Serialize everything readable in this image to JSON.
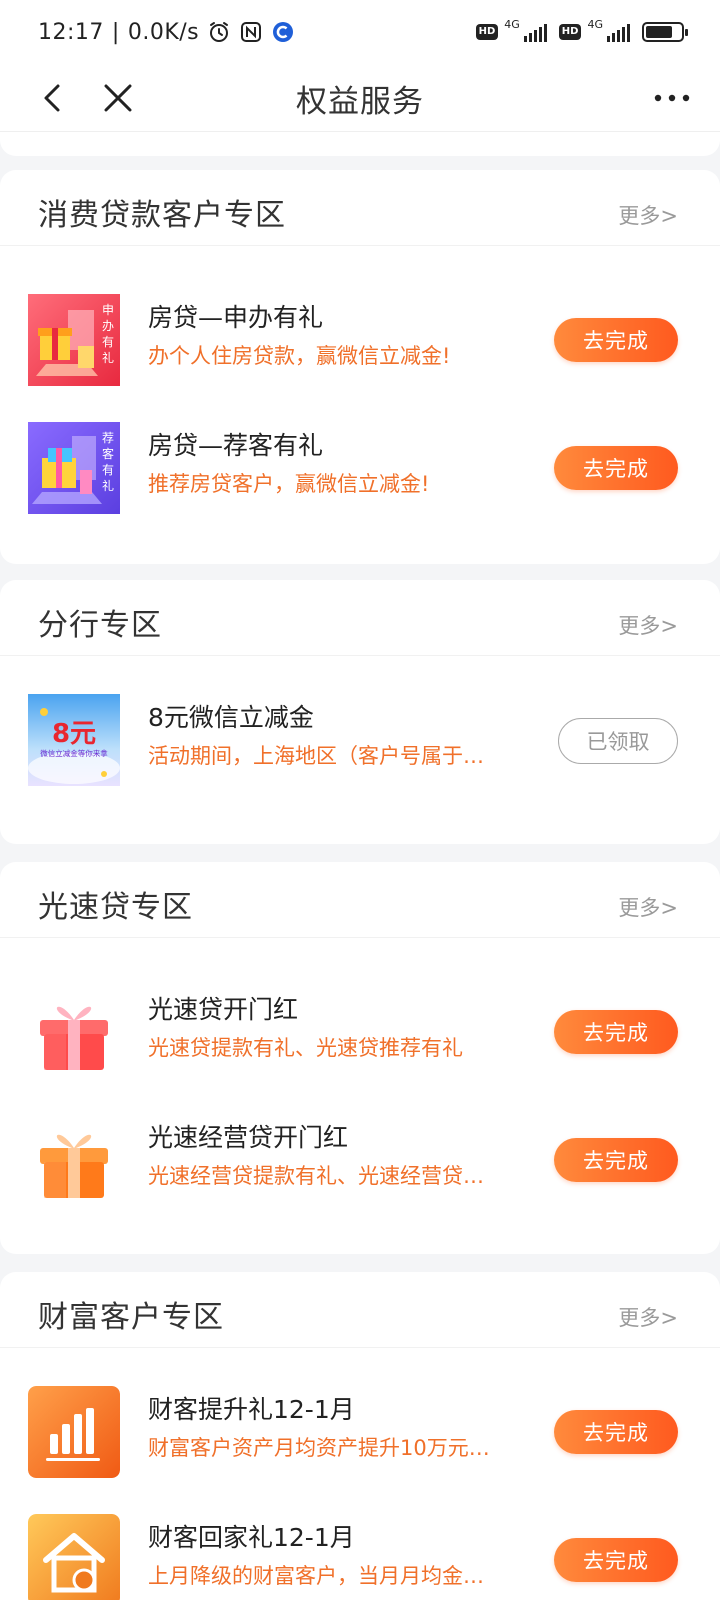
{
  "status_bar": {
    "time": "12:17",
    "speed": "0.0K/s",
    "net1": "4G",
    "net2": "4G",
    "hd1": "HD",
    "hd2": "HD",
    "battery_level": 0.75
  },
  "nav": {
    "title": "权益服务"
  },
  "sections": [
    {
      "title": "消费贷款客户专区",
      "more": "更多>",
      "items": [
        {
          "title": "房贷—申办有礼",
          "desc": "办个人住房贷款，赢微信立减金!",
          "button": "去完成",
          "icon": "house-loan-apply-thumbnail",
          "thumb_text": "申办有礼"
        },
        {
          "title": "房贷—荐客有礼",
          "desc": "推荐房贷客户，赢微信立减金!",
          "button": "去完成",
          "icon": "house-loan-referral-thumbnail",
          "thumb_text": "荐客有礼"
        }
      ]
    },
    {
      "title": "分行专区",
      "more": "更多>",
      "items": [
        {
          "title": "8元微信立减金",
          "desc": "活动期间，上海地区（客户号属于…",
          "button": "已领取",
          "icon": "wechat-coupon-thumbnail",
          "thumb_big": "8元",
          "thumb_small": "微信立减金等你来拿"
        }
      ]
    },
    {
      "title": "光速贷专区",
      "more": "更多>",
      "items": [
        {
          "title": "光速贷开门红",
          "desc": "光速贷提款有礼、光速贷推荐有礼",
          "button": "去完成",
          "icon": "red-gift-box-icon"
        },
        {
          "title": "光速经营贷开门红",
          "desc": "光速经营贷提款有礼、光速经营贷…",
          "button": "去完成",
          "icon": "orange-gift-box-icon"
        }
      ]
    },
    {
      "title": "财富客户专区",
      "more": "更多>",
      "items": [
        {
          "title": "财客提升礼12-1月",
          "desc": "财富客户资产月均资产提升10万元…",
          "button": "去完成",
          "icon": "bar-chart-icon"
        },
        {
          "title": "财客回家礼12-1月",
          "desc": "上月降级的财富客户，当月月均金…",
          "button": "去完成",
          "icon": "home-icon"
        }
      ]
    }
  ],
  "colors": {
    "accent": "#ff6a26",
    "desc_text": "#f0702a",
    "background": "#f4f5f7"
  }
}
